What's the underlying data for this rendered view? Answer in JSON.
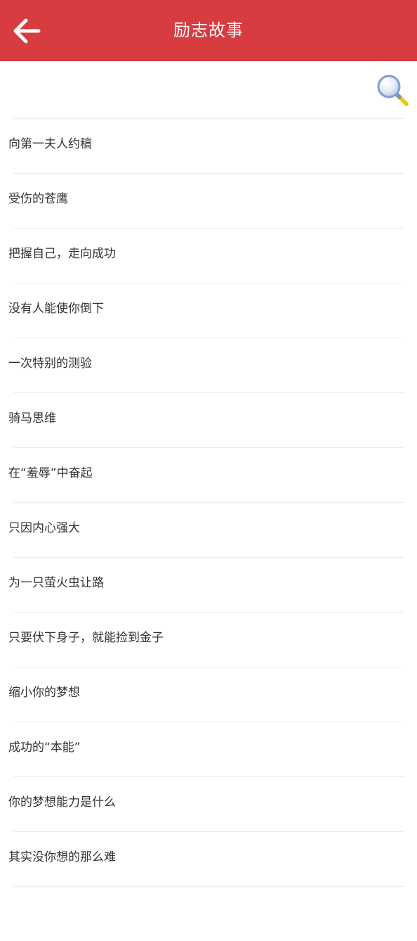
{
  "header": {
    "title": "励志故事",
    "back_icon": "arrow-left-icon",
    "background_color": "#d63c40"
  },
  "search": {
    "icon": "magnifier-icon"
  },
  "stories": [
    "向第一夫人约稿",
    "受伤的苍鹰",
    "把握自己，走向成功",
    "没有人能使你倒下",
    "一次特别的测验",
    "骑马思维",
    "在“羞辱”中奋起",
    "只因内心强大",
    "为一只萤火虫让路",
    "只要伏下身子，就能捡到金子",
    "缩小你的梦想",
    "成功的“本能”",
    "你的梦想能力是什么",
    "其实没你想的那么难"
  ]
}
